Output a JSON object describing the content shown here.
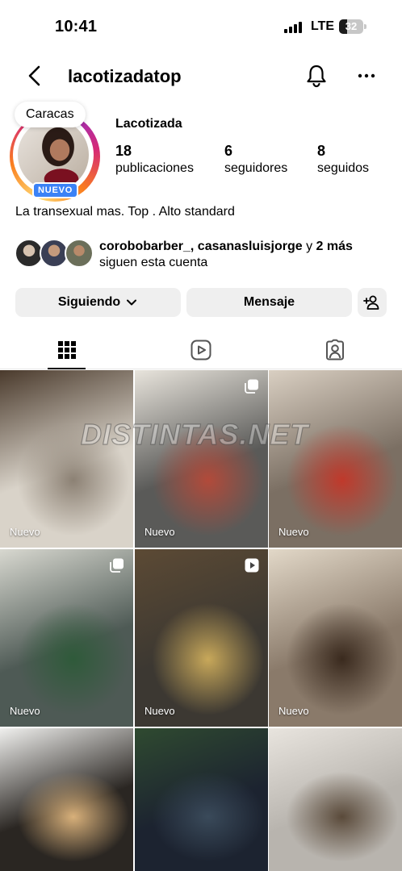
{
  "status_bar": {
    "time": "10:41",
    "network": "LTE",
    "battery": "32"
  },
  "header": {
    "username": "lacotizadatop"
  },
  "profile": {
    "location_note": "Caracas",
    "new_badge": "NUEVO",
    "display_name": "Lacotizada",
    "stats": [
      {
        "value": "18",
        "label": "publicaciones"
      },
      {
        "value": "6",
        "label": "seguidores"
      },
      {
        "value": "8",
        "label": "seguidos"
      }
    ],
    "bio": "La transexual mas. Top . Alto standard",
    "followed_by": {
      "names": "corobobarber_, casanasluisjorge",
      "connector": " y ",
      "more": "2 más",
      "suffix": "siguen esta cuenta"
    }
  },
  "actions": {
    "following_label": "Siguiendo",
    "message_label": "Mensaje"
  },
  "tabs": [
    "grid",
    "reels",
    "tagged"
  ],
  "posts": [
    {
      "label": "Nuevo",
      "type": "photo",
      "colors": [
        "#d9d3c9",
        "#8c8174",
        "#4a3a2c"
      ]
    },
    {
      "label": "Nuevo",
      "type": "carousel",
      "colors": [
        "#5a5a58",
        "#b24a3a",
        "#e8e4dc"
      ]
    },
    {
      "label": "Nuevo",
      "type": "photo",
      "colors": [
        "#7b6f63",
        "#c0392b",
        "#d9cfc2"
      ]
    },
    {
      "label": "Nuevo",
      "type": "carousel",
      "colors": [
        "#4e5a55",
        "#2f5a3a",
        "#d8d8d0"
      ]
    },
    {
      "label": "Nuevo",
      "type": "reel",
      "colors": [
        "#3c3832",
        "#c8a85a",
        "#5c4a34"
      ]
    },
    {
      "label": "Nuevo",
      "type": "photo",
      "colors": [
        "#8a7a6a",
        "#3a2a1e",
        "#e2d8c8"
      ]
    },
    {
      "label": "",
      "type": "photo",
      "colors": [
        "#2a2622",
        "#d8b07a",
        "#f0f0ee"
      ]
    },
    {
      "label": "",
      "type": "photo",
      "colors": [
        "#1c2330",
        "#3a4a5a",
        "#2f4a30"
      ]
    },
    {
      "label": "",
      "type": "photo",
      "colors": [
        "#b8b4ae",
        "#5a4a3a",
        "#e8e4de"
      ]
    }
  ],
  "watermark": "DISTINTAS.NET"
}
